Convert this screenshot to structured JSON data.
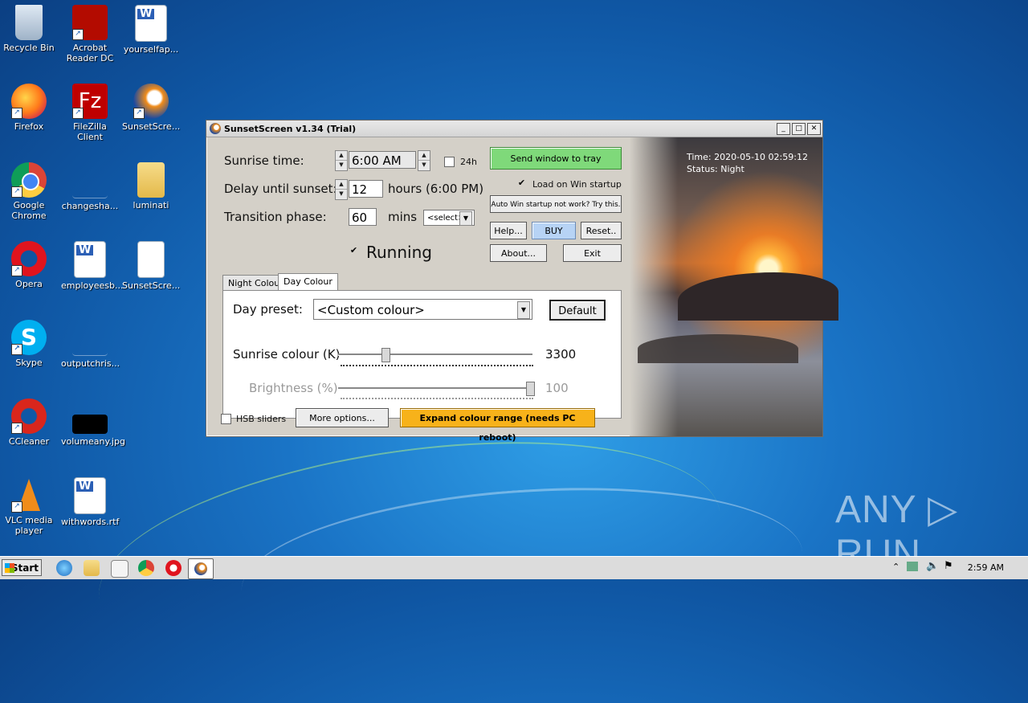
{
  "desktop": {
    "icons": [
      {
        "label": "Recycle Bin"
      },
      {
        "label": "Acrobat Reader DC"
      },
      {
        "label": "yourselfap..."
      },
      {
        "label": "Firefox"
      },
      {
        "label": "FileZilla Client"
      },
      {
        "label": "SunsetScre..."
      },
      {
        "label": "Google Chrome"
      },
      {
        "label": "changesha..."
      },
      {
        "label": "luminati"
      },
      {
        "label": "Opera"
      },
      {
        "label": "employeesb..."
      },
      {
        "label": "SunsetScre..."
      },
      {
        "label": "Skype"
      },
      {
        "label": "outputchris..."
      },
      {
        "label": "CCleaner"
      },
      {
        "label": "volumeany.jpg"
      },
      {
        "label": "VLC media player"
      },
      {
        "label": "withwords.rtf"
      }
    ]
  },
  "window": {
    "title": "SunsetScreen v1.34 (Trial)",
    "sunrise_label": "Sunrise time:",
    "sunrise_value": "6:00 AM",
    "h24_label": "24h",
    "delay_label": "Delay until sunset:",
    "delay_value": "12",
    "delay_unit": "hours  (6:00 PM)",
    "transition_label": "Transition phase:",
    "transition_value": "60",
    "transition_unit": "mins",
    "transition_select": "<select>",
    "running_label": "Running",
    "send_tray": "Send window to tray",
    "load_startup": "Load on Win startup",
    "auto_startup": "Auto Win startup not work? Try this.",
    "help": "Help...",
    "buy": "BUY",
    "reset": "Reset..",
    "about": "About...",
    "exit": "Exit",
    "time_text": "Time: 2020-05-10 02:59:12",
    "status_text": "Status: Night",
    "tab_night": "Night Colour",
    "tab_day": "Day Colour",
    "day_preset_label": "Day preset:",
    "day_preset_value": "<Custom colour>",
    "default_btn": "Default",
    "sunrise_colour_label": "Sunrise colour (K)",
    "sunrise_colour_value": "3300",
    "brightness_label": "Brightness (%)",
    "brightness_value": "100",
    "hsb_label": "HSB sliders",
    "more_options": "More options...",
    "expand_range": "Expand colour range (needs PC reboot)"
  },
  "taskbar": {
    "start": "Start",
    "clock": "2:59 AM"
  },
  "watermark": "ANY ▷ RUN",
  "colors": {
    "accent_green": "#7fd97a",
    "buy_blue": "#b7d3f5",
    "orange": "#f7b21a"
  }
}
